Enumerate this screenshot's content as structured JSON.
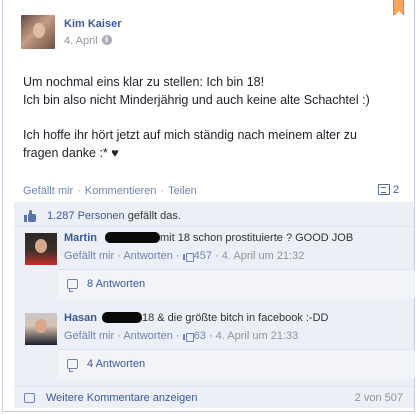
{
  "post": {
    "author": "Kim Kaiser",
    "date": "4. April",
    "privacy_icon": "globe-icon",
    "lines": [
      "Um nochmal eins klar zu stellen: Ich bin 18!",
      "Ich bin also nicht Minderjährig und auch keine alte Schachtel :)",
      "Ich hoffe ihr hört jetzt auf mich ständig nach meinem alter zu",
      "fragen danke :* ♥"
    ]
  },
  "actions": {
    "like": "Gefällt mir",
    "comment": "Kommentieren",
    "share": "Teilen",
    "separator": "·",
    "comment_count": "2"
  },
  "likes": {
    "count": "1.287 Personen",
    "suffix": " gefällt das."
  },
  "comments": [
    {
      "name": "Martin",
      "text": "mit 18 schon prostituierte ? GOOD JOB",
      "like_label": "Gefällt mir",
      "reply_label": "Antworten",
      "likes": "457",
      "date": "4. April um 21:32",
      "replies": "8 Antworten"
    },
    {
      "name": "Hasan",
      "text": "18 & die größte bitch in facebook :-DD",
      "like_label": "Gefällt mir",
      "reply_label": "Antworten",
      "likes": "63",
      "date": "4. April um 21:33",
      "replies": "4 Antworten"
    }
  ],
  "more": {
    "label": "Weitere Kommentare anzeigen",
    "count": "2 von 507"
  },
  "colors": {
    "link": "#3b5998",
    "feed_bg": "#eceff5",
    "bookmark": "#f7a35c"
  }
}
